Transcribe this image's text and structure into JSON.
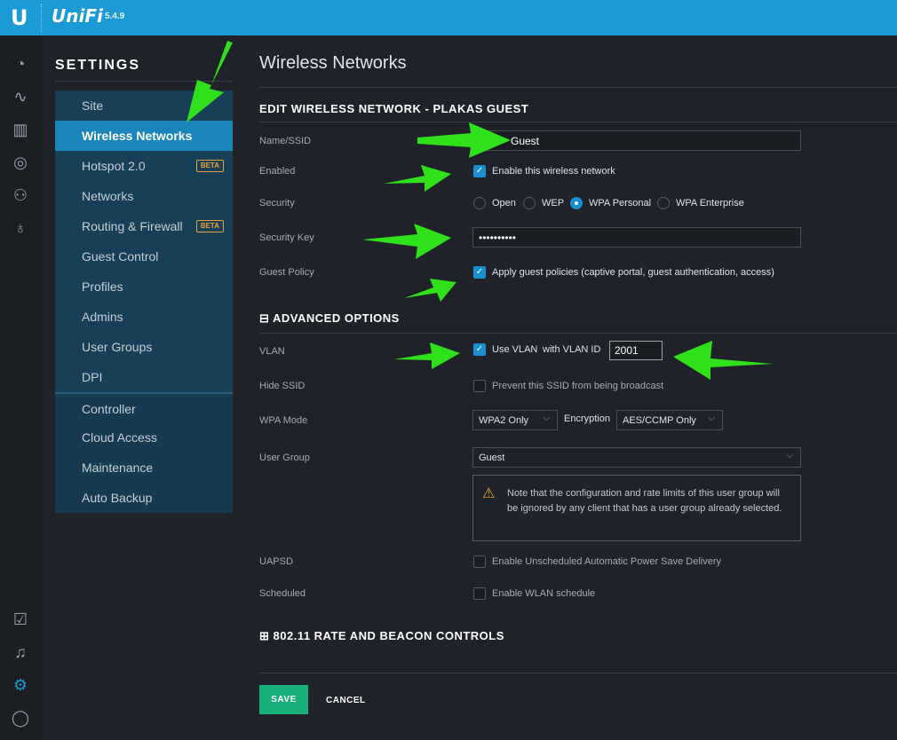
{
  "header": {
    "logo": "U",
    "brand": "UniFi",
    "version": "5.4.9"
  },
  "rail": {
    "icons": [
      "dashboard-icon",
      "statistics-icon",
      "map-icon",
      "devices-icon",
      "clients-icon",
      "insights-icon"
    ],
    "bottom_icons": [
      "tasks-icon",
      "alerts-icon",
      "settings-icon",
      "chat-icon"
    ]
  },
  "sidebar": {
    "title": "SETTINGS",
    "items": [
      {
        "label": "Site"
      },
      {
        "label": "Wireless Networks",
        "selected": true
      },
      {
        "label": "Hotspot 2.0",
        "badge": "BETA"
      },
      {
        "label": "Networks"
      },
      {
        "label": "Routing & Firewall",
        "badge": "BETA"
      },
      {
        "label": "Guest Control"
      },
      {
        "label": "Profiles"
      },
      {
        "label": "Admins"
      },
      {
        "label": "User Groups"
      },
      {
        "label": "DPI"
      },
      {
        "label": "Controller"
      },
      {
        "label": "Cloud Access"
      },
      {
        "label": "Maintenance"
      },
      {
        "label": "Auto Backup"
      }
    ]
  },
  "main": {
    "page_title": "Wireless Networks",
    "section_title": "EDIT WIRELESS NETWORK - PLAKAS GUEST",
    "fields": {
      "name_label": "Name/SSID",
      "name_value": "Guest",
      "enabled_label": "Enabled",
      "enabled_text": "Enable this wireless network",
      "enabled_checked": true,
      "security_label": "Security",
      "security_options": [
        "Open",
        "WEP",
        "WPA Personal",
        "WPA Enterprise"
      ],
      "security_selected": "WPA Personal",
      "key_label": "Security Key",
      "key_value": "••••••••••",
      "guest_label": "Guest Policy",
      "guest_text": "Apply guest policies (captive portal, guest authentication, access)",
      "guest_checked": true
    },
    "advanced": {
      "title": "ADVANCED OPTIONS",
      "vlan_label": "VLAN",
      "vlan_text": "Use VLAN",
      "vlan_id_label": "with VLAN ID",
      "vlan_id": "2001",
      "vlan_checked": true,
      "hide_label": "Hide SSID",
      "hide_text": "Prevent this SSID from being broadcast",
      "hide_checked": false,
      "wpa_label": "WPA Mode",
      "wpa_value": "WPA2 Only",
      "enc_label": "Encryption",
      "enc_value": "AES/CCMP Only",
      "group_label": "User Group",
      "group_value": "Guest",
      "note": "Note that the configuration and rate limits of this user group will be ignored by any client that has a user group already selected.",
      "uapsd_label": "UAPSD",
      "uapsd_text": "Enable Unscheduled Automatic Power Save Delivery",
      "uapsd_checked": false,
      "sched_label": "Scheduled",
      "sched_text": "Enable WLAN schedule",
      "sched_checked": false
    },
    "rate_title": "802.11 RATE AND BEACON CONTROLS",
    "save_label": "SAVE",
    "cancel_label": "CANCEL"
  },
  "colors": {
    "topbar": "#1b9ad6",
    "selected": "#1a86bb",
    "save": "#17b07a",
    "annotation_arrow": "#2fe01a"
  }
}
